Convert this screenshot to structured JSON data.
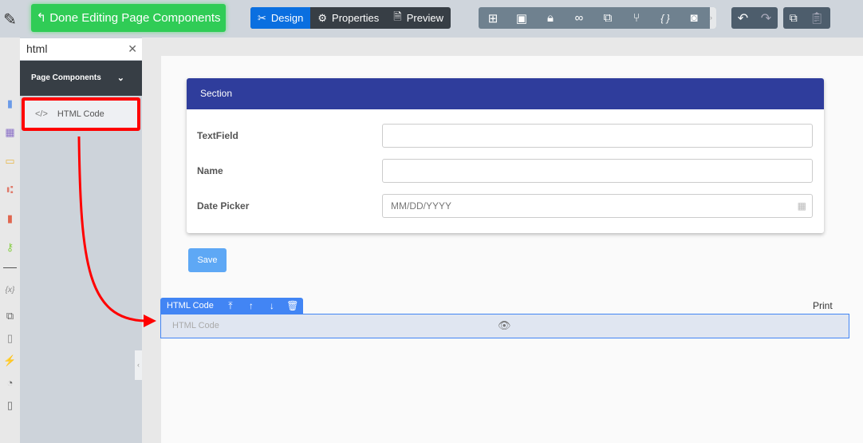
{
  "toolbar": {
    "done_label": "Done Editing Page Components",
    "modes": [
      {
        "label": "Design",
        "active": true
      },
      {
        "label": "Properties"
      },
      {
        "label": "Preview"
      }
    ],
    "tools": [
      "sitemap-icon",
      "database-icon",
      "lock-icon",
      "binoculars-icon",
      "translate-icon",
      "branch-icon",
      "code-braces-icon",
      "camera-icon"
    ]
  },
  "sidebar": {
    "search_value": "html",
    "section_title": "Page Components",
    "items": [
      {
        "label": "HTML Code"
      }
    ]
  },
  "form": {
    "section_title": "Section",
    "fields": [
      {
        "label": "TextField",
        "value": ""
      },
      {
        "label": "Name",
        "value": ""
      },
      {
        "label": "Date Picker",
        "placeholder": "MM/DD/YYYY"
      }
    ],
    "save_label": "Save"
  },
  "html_component": {
    "toolbar_label": "HTML Code",
    "body_label": "HTML Code"
  },
  "print_label": "Print",
  "colors": {
    "accent": "#0a6fe0",
    "done": "#30cc56",
    "section": "#2f3d9c",
    "highlight": "#ff0000"
  }
}
